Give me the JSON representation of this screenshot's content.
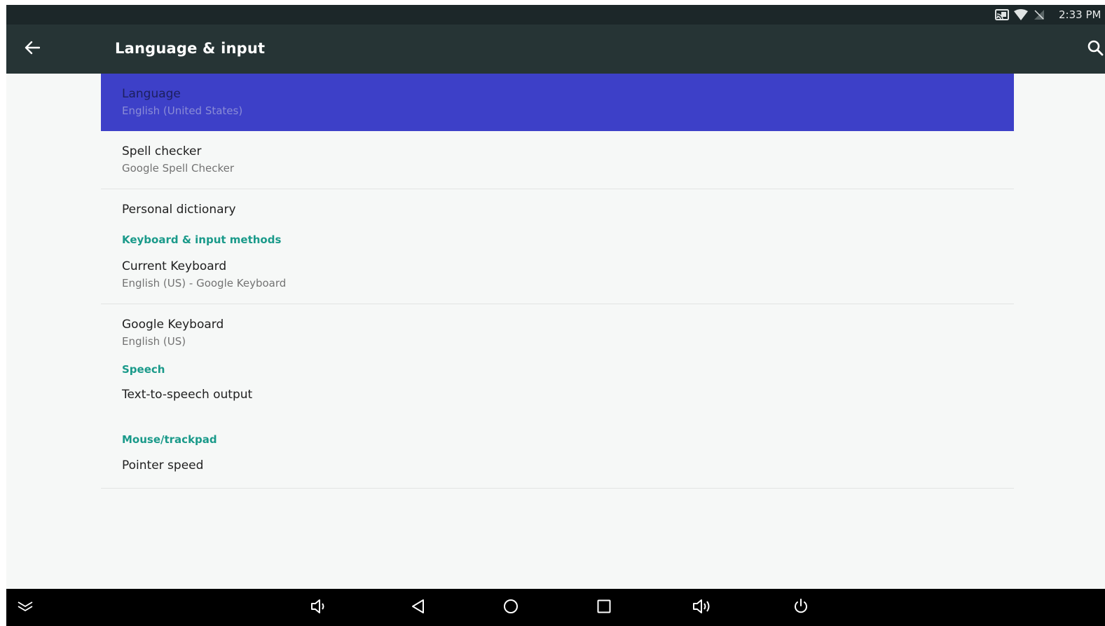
{
  "status_bar": {
    "time": "2:33 PM",
    "icons": [
      "cast-icon",
      "wifi-icon",
      "no-signal-icon"
    ]
  },
  "toolbar": {
    "title": "Language & input",
    "back_icon": "arrow-back-icon",
    "search_icon": "search-icon"
  },
  "settings": {
    "language": {
      "title": "Language",
      "summary": "English (United States)"
    },
    "spell_checker": {
      "title": "Spell checker",
      "summary": "Google Spell Checker"
    },
    "personal_dictionary": {
      "title": "Personal dictionary"
    },
    "keyboard_category": "Keyboard & input methods",
    "current_keyboard": {
      "title": "Current Keyboard",
      "summary": "English (US) - Google Keyboard"
    },
    "google_keyboard": {
      "title": "Google Keyboard",
      "summary": "English (US)"
    },
    "speech_category": "Speech",
    "tts": {
      "title": "Text-to-speech output"
    },
    "mouse_category": "Mouse/trackpad",
    "pointer_speed": {
      "title": "Pointer speed"
    }
  },
  "nav_bar": {
    "buttons": [
      "collapse-icon",
      "volume-down-icon",
      "back-icon",
      "home-icon",
      "recents-icon",
      "volume-up-icon",
      "power-icon"
    ]
  },
  "colors": {
    "status_bar": "#1c2729",
    "toolbar": "#263435",
    "selected_row": "#3d40c8",
    "category_accent": "#1a9a8a",
    "nav_bar": "#000000"
  }
}
